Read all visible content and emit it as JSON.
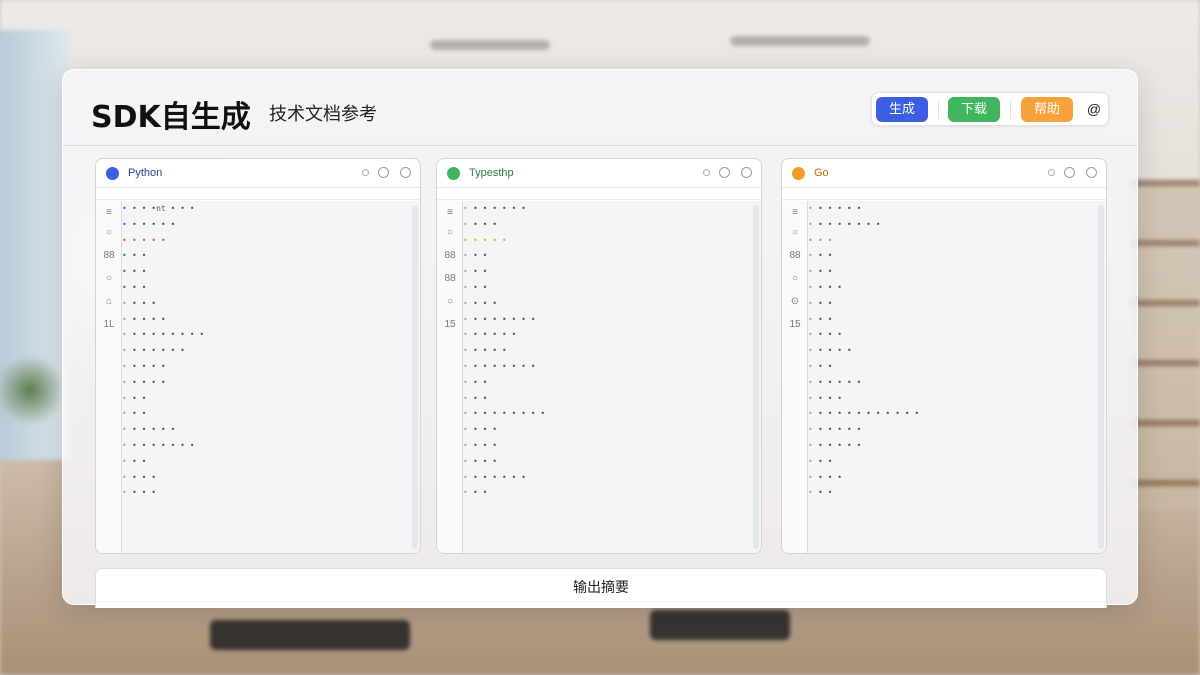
{
  "header": {
    "title": "SDK自生成",
    "subtitle": "技术文档参考"
  },
  "toolbar": {
    "generate_label": "生成",
    "download_label": "下载",
    "help_label": "帮助",
    "extra_icon": "at-icon"
  },
  "editors": [
    {
      "language": "Python",
      "accent": "#3b5fe0",
      "marker_color": "#3b5fe0",
      "highlight_color": "#e0541c",
      "gutter": [
        "≡",
        "○",
        "88",
        "○",
        "⌂",
        "1L"
      ],
      "lines": [
        "• • •nt • • •",
        "• • • • •",
        "• • • •",
        "• •",
        "• •",
        "• •",
        "• • •",
        "• • • •",
        "• • • • • • • •",
        "• • • • • •",
        "• • • •",
        "• • • •",
        "• •",
        "• •",
        "• • • • •",
        "• • • • • • •",
        "• •",
        "• • •",
        "• • •"
      ]
    },
    {
      "language": "Typesthp",
      "accent": "#3fb55c",
      "marker_color": "#9a9aa0",
      "highlight_color": "#e6b400",
      "gutter": [
        "≡",
        "○",
        "88",
        "88",
        "○",
        "15"
      ],
      "lines": [
        "• • • • • •",
        "• • •",
        "• • • •",
        "• •",
        "• •",
        "• •",
        "• • •",
        "• • • • • • •",
        "• • • • •",
        "• • • •",
        "• • • • • • •",
        "• •",
        "• •",
        "• • • • • • • •",
        "• • •",
        "• • •",
        "• • •",
        "• • • • • •",
        "• •"
      ]
    },
    {
      "language": "Go",
      "accent": "#f39a2b",
      "marker_color": "#9a9aa0",
      "highlight_color": "#9a9aa0",
      "gutter": [
        "≡",
        "○",
        "88",
        "○",
        "⊙",
        "15"
      ],
      "lines": [
        "• • • • •",
        "• • • • • • •",
        "• •",
        "• •",
        "• •",
        "• • •",
        "• •",
        "• •",
        "• • •",
        "• • • •",
        "• •",
        "• • • • •",
        "• • •",
        "• • • • • • • • • • •",
        "• • • • •",
        "• • • • •",
        "• •",
        "• • •",
        "• •"
      ]
    }
  ],
  "output": {
    "title": "输出摘要"
  }
}
